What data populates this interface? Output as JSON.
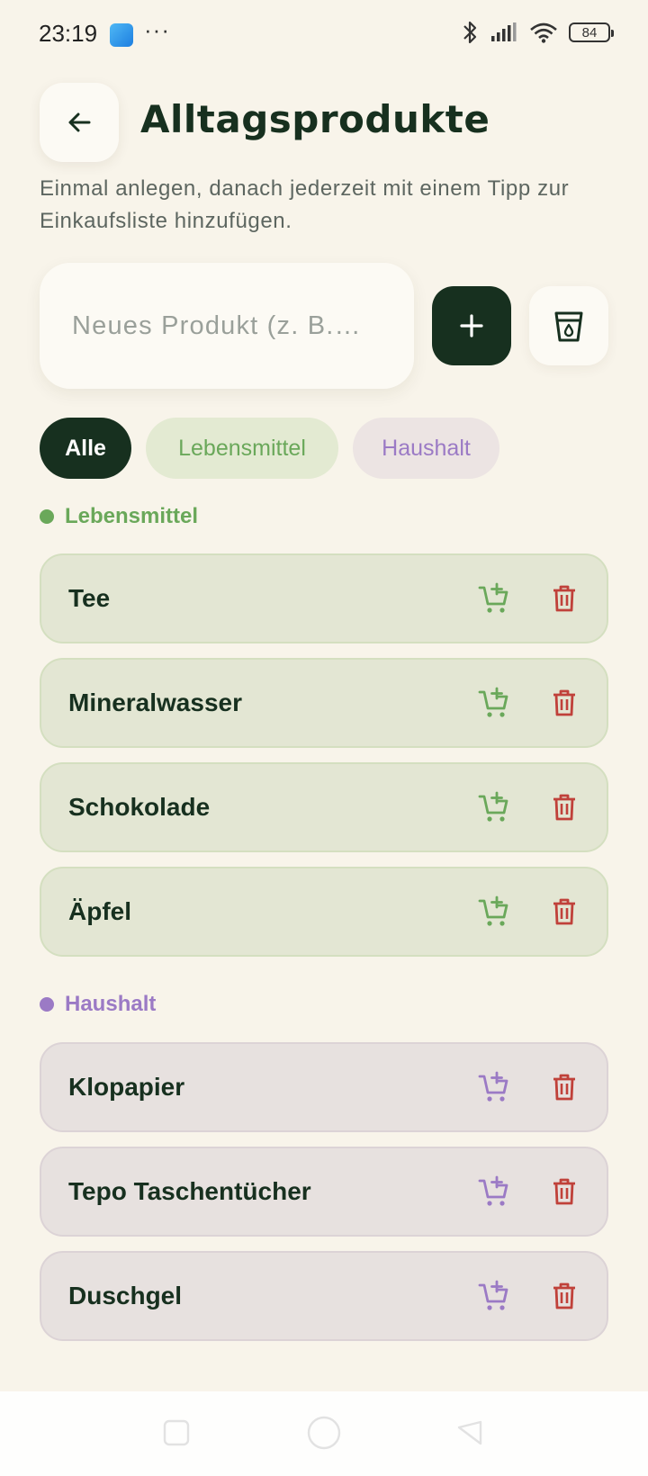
{
  "status_bar": {
    "time": "23:19",
    "dots": "···",
    "battery": "84"
  },
  "header": {
    "title": "Alltagsprodukte",
    "subtitle": "Einmal anlegen, danach jederzeit mit einem Tipp zur Einkaufsliste hinzufügen."
  },
  "new_product": {
    "placeholder": "Neues Produkt (z. B.…"
  },
  "filters": [
    {
      "label": "Alle",
      "active": true
    },
    {
      "label": "Lebensmittel",
      "active": false
    },
    {
      "label": "Haushalt",
      "active": false
    }
  ],
  "sections": [
    {
      "title": "Lebensmittel",
      "color": "#6aa85a",
      "items": [
        "Tee",
        "Mineralwasser",
        "Schokolade",
        "Äpfel"
      ]
    },
    {
      "title": "Haushalt",
      "color": "#9b7ac5",
      "items": [
        "Klopapier",
        "Tepo Taschentücher",
        "Duschgel"
      ]
    }
  ],
  "colors": {
    "background": "#f8f4ea",
    "primary_dark": "#17301f",
    "food_accent": "#6aa85a",
    "house_accent": "#9b7ac5",
    "delete_red": "#c0413a"
  },
  "icons": {
    "back": "arrow-left-icon",
    "add": "plus-icon",
    "waste": "bin-icon",
    "add_to_cart": "cart-plus-icon",
    "delete": "trash-icon"
  }
}
